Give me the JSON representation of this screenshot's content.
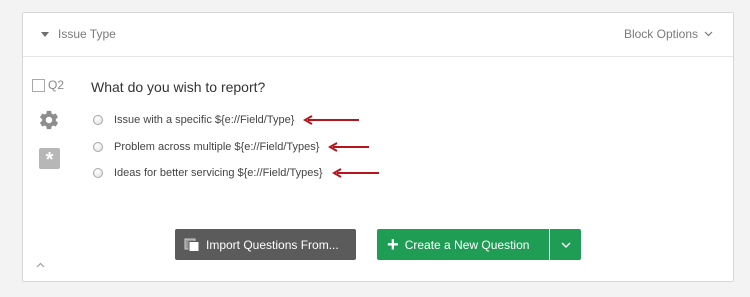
{
  "block": {
    "title": "Issue Type",
    "options_label": "Block Options"
  },
  "question": {
    "number": "Q2",
    "text": "What do you wish to report?",
    "choices": [
      {
        "label": "Issue with a specific ${e://Field/Type}"
      },
      {
        "label": "Problem across multiple ${e://Field/Types}"
      },
      {
        "label": "Ideas for better servicing ${e://Field/Types}"
      }
    ]
  },
  "buttons": {
    "import_label": "Import Questions From...",
    "create_label": "Create a New Question"
  },
  "icons": {
    "collapse": "caret-down-icon",
    "options_chevron": "chevron-down-icon",
    "settings": "gear-icon",
    "validation": "asterisk-icon",
    "import": "copy-icon",
    "create": "plus-icon",
    "create_menu": "chevron-down-icon",
    "annotation": "arrow-left-icon",
    "expand": "caret-up-icon"
  },
  "colors": {
    "create_button": "#1f9d55",
    "import_button": "#5b5b5b",
    "annotation_arrow": "#b5161e"
  }
}
